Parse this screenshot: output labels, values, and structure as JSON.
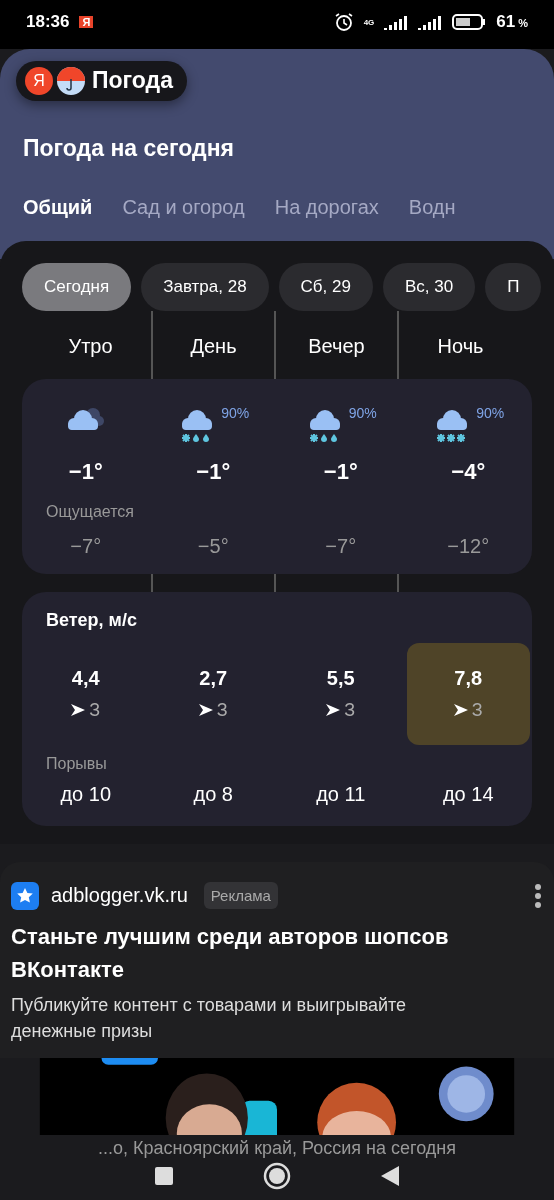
{
  "status_bar": {
    "time": "18:36",
    "app_badge": "Я",
    "network": "4G",
    "battery_percent": "61",
    "percent_sign": "%"
  },
  "header": {
    "logo_letter": "Я",
    "app_name": "Погода",
    "title": "Погода на сегодня"
  },
  "tabs": [
    {
      "label": "Общий",
      "selected": true
    },
    {
      "label": "Сад и огород",
      "selected": false
    },
    {
      "label": "На дорогах",
      "selected": false
    },
    {
      "label": "Водн",
      "selected": false
    }
  ],
  "days": [
    {
      "label": "Сегодня",
      "selected": true
    },
    {
      "label": "Завтра, 28",
      "selected": false
    },
    {
      "label": "Сб, 29",
      "selected": false
    },
    {
      "label": "Вс, 30",
      "selected": false
    },
    {
      "label": "П",
      "selected": false
    }
  ],
  "periods": [
    {
      "name": "Утро",
      "kind": "cloudy",
      "temp": "−1°",
      "feels": "−7°"
    },
    {
      "name": "День",
      "kind": "sleet",
      "chance": "90%",
      "temp": "−1°",
      "feels": "−5°"
    },
    {
      "name": "Вечер",
      "kind": "sleet",
      "chance": "90%",
      "temp": "−1°",
      "feels": "−7°"
    },
    {
      "name": "Ночь",
      "kind": "snow",
      "chance": "90%",
      "temp": "−4°",
      "feels": "−12°"
    }
  ],
  "feels_label": "Ощущается",
  "wind": {
    "title": "Ветер, м/с",
    "gusts_label": "Порывы",
    "items": [
      {
        "speed": "4,4",
        "direction": "З",
        "gust": "до 10",
        "highlighted": false
      },
      {
        "speed": "2,7",
        "direction": "З",
        "gust": "до 8",
        "highlighted": false
      },
      {
        "speed": "5,5",
        "direction": "З",
        "gust": "до 11",
        "highlighted": false
      },
      {
        "speed": "7,8",
        "direction": "З",
        "gust": "до 14",
        "highlighted": true
      }
    ]
  },
  "ad": {
    "domain": "adblogger.vk.ru",
    "badge": "Реклама",
    "title": "Станьте лучшим среди авторов шопсов ВКонтакте",
    "text": "Публикуйте контент с товарами и выигрывайте денежные призы",
    "kind": "picture"
  },
  "footer": {
    "text": "...о, Красноярский край, Россия на сегодня"
  }
}
